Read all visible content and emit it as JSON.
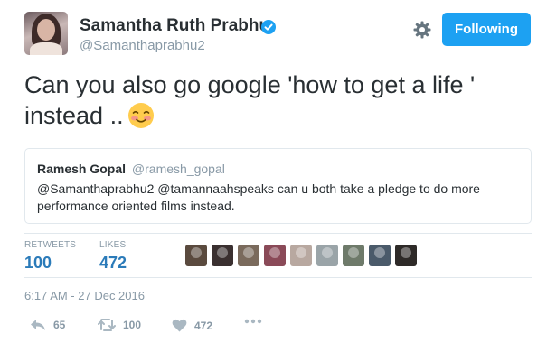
{
  "user": {
    "display_name": "Samantha Ruth Prabhu",
    "handle": "@Samanthaprabhu2"
  },
  "follow_button": {
    "label": "Following"
  },
  "tweet": {
    "text": "Can you also go google 'how to get a life ' instead .."
  },
  "quoted_tweet": {
    "name": "Ramesh Gopal",
    "handle": "@ramesh_gopal",
    "text": "@Samanthaprabhu2 @tamannaahspeaks can u both take a pledge to do more performance oriented films instead."
  },
  "stats": {
    "retweets_label": "RETWEETS",
    "retweets_value": "100",
    "likes_label": "LIKES",
    "likes_value": "472"
  },
  "likers": [
    "liker-1",
    "liker-2",
    "liker-3",
    "liker-4",
    "liker-5",
    "liker-6",
    "liker-7",
    "liker-8",
    "liker-9"
  ],
  "timestamp": "6:17 AM - 27 Dec 2016",
  "actions": {
    "reply_count": "65",
    "retweet_count": "100",
    "like_count": "472"
  },
  "colors": {
    "accent": "#1da1f2",
    "stat_value": "#2b7bb9",
    "muted": "#8899a6"
  }
}
